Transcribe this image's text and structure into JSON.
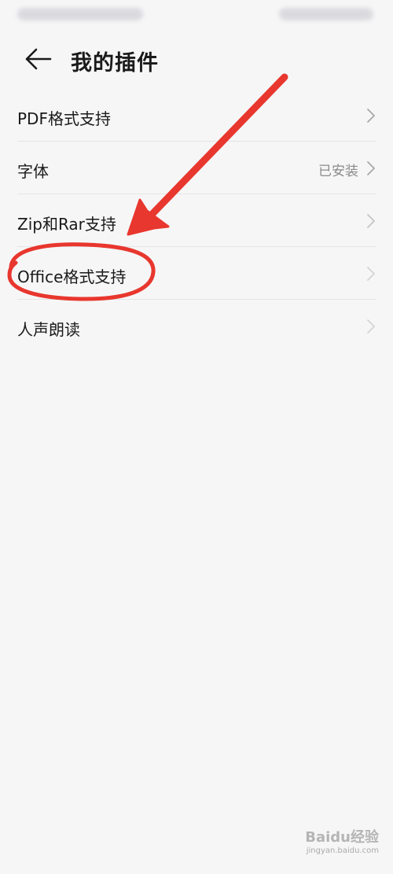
{
  "header": {
    "title": "我的插件"
  },
  "plugins": [
    {
      "label": "PDF格式支持",
      "value": ""
    },
    {
      "label": "字体",
      "value": "已安装"
    },
    {
      "label": "Zip和Rar支持",
      "value": ""
    },
    {
      "label": "Office格式支持",
      "value": ""
    },
    {
      "label": "人声朗读",
      "value": ""
    }
  ],
  "watermark": {
    "text": "Baidu经验",
    "sub": "jingyan.baidu.com"
  },
  "colors": {
    "background": "#f6f6f7",
    "annotation_red": "#e8372e",
    "secondary_text": "#8a8a8a"
  },
  "icons": {
    "back": "arrow-left-icon",
    "row": "chevron-right-icon"
  }
}
